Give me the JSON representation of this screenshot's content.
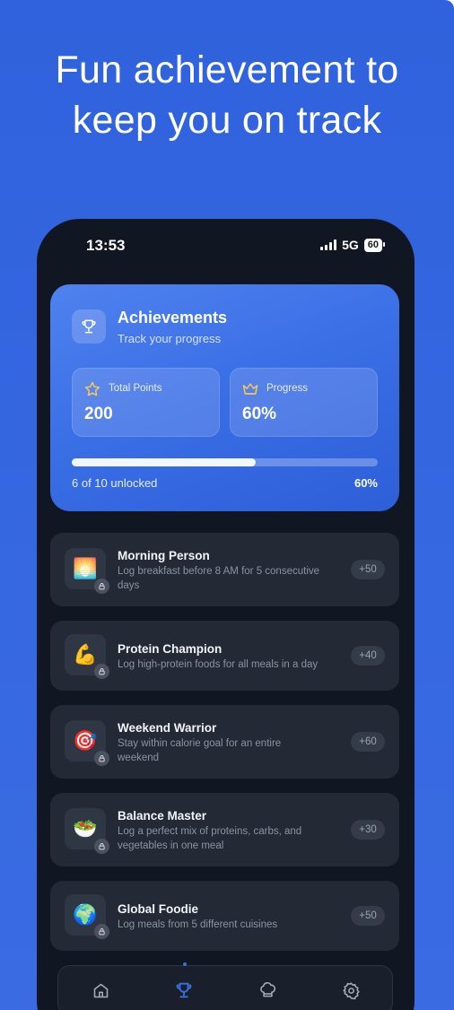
{
  "headline": {
    "line1": "Fun achievement to",
    "line2": "keep you on track"
  },
  "status_bar": {
    "time": "13:53",
    "network": "5G",
    "battery": "60"
  },
  "achievements_card": {
    "title": "Achievements",
    "subtitle": "Track your progress",
    "icon": "trophy-icon",
    "stats": [
      {
        "label": "Total Points",
        "value": "200",
        "icon": "star-icon"
      },
      {
        "label": "Progress",
        "value": "60%",
        "icon": "crown-icon"
      }
    ],
    "progress_fraction": 0.6,
    "unlocked_text": "6 of 10 unlocked",
    "progress_text": "60%"
  },
  "achievements": [
    {
      "title": "Morning Person",
      "description": "Log breakfast before 8 AM for 5 consecutive days",
      "points": "+50",
      "icon": "sunrise-icon",
      "emoji": "🌅"
    },
    {
      "title": "Protein Champion",
      "description": "Log high-protein foods for all meals in a day",
      "points": "+40",
      "icon": "flexed-biceps-icon",
      "emoji": "💪"
    },
    {
      "title": "Weekend Warrior",
      "description": "Stay within calorie goal for an entire weekend",
      "points": "+60",
      "icon": "target-icon",
      "emoji": "🎯"
    },
    {
      "title": "Balance Master",
      "description": "Log a perfect mix of proteins, carbs, and vegetables in one meal",
      "points": "+30",
      "icon": "salad-icon",
      "emoji": "🥗"
    },
    {
      "title": "Global Foodie",
      "description": "Log meals from 5 different cuisines",
      "points": "+50",
      "icon": "globe-icon",
      "emoji": "🌍"
    }
  ],
  "nav": {
    "items": [
      "home-icon",
      "trophy-icon",
      "chef-hat-icon",
      "gear-icon"
    ],
    "active": "trophy-icon",
    "accent": "#3b6fe6"
  }
}
